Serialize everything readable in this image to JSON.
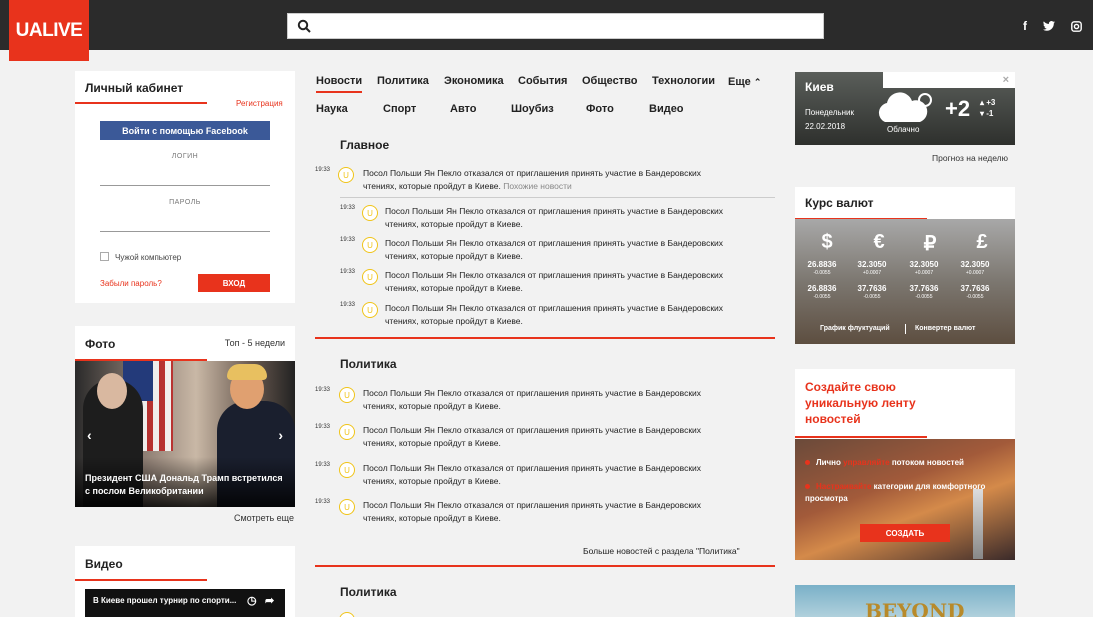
{
  "header": {
    "logo": "UALIVE",
    "search_placeholder": "",
    "social": [
      "f",
      "t",
      "ig"
    ]
  },
  "login": {
    "title": "Личный кабинет",
    "register": "Регистрация",
    "facebook": "Войти с помощью Facebook",
    "login_label": "ЛОГИН",
    "password_label": "ПАРОЛЬ",
    "remember": "Чужой компьютер",
    "forgot": "Забыли пароль?",
    "submit": "ВХОД"
  },
  "photo": {
    "title": "Фото",
    "filter": "Топ - 5 недели",
    "caption": "Президент США Дональд Трамп встретился с послом Великобритании",
    "more": "Смотреть еще"
  },
  "video": {
    "title": "Видео",
    "caption": "В Киеве прошел турнир по спорти..."
  },
  "tabs_row1": [
    "Новости",
    "Политика",
    "Экономика",
    "События",
    "Общество",
    "Технологии",
    "Еще"
  ],
  "tabs_row2": [
    "Наука",
    "Спорт",
    "Авто",
    "Шоубиз",
    "Фото",
    "Видео"
  ],
  "main": {
    "title": "Главное",
    "headline": {
      "time": "19:33",
      "line1": "Посол Польши Ян Пекло отказался от приглашения принять участие в Бандеровских",
      "line2": "чтениях, которые пройдут в Киеве.",
      "similar": "Похожие новости"
    },
    "related": [
      {
        "time": "19:33",
        "line1": "Посол Польши Ян Пекло отказался от приглашения принять участие в Бандеровских",
        "line2": "чтениях, которые пройдут в Киеве."
      },
      {
        "time": "19:33",
        "line1": "Посол Польши Ян Пекло отказался от приглашения принять участие в Бандеровских",
        "line2": "чтениях, которые пройдут в Киеве."
      },
      {
        "time": "19:33",
        "line1": "Посол Польши Ян Пекло отказался от приглашения принять участие в Бандеровских",
        "line2": "чтениях, которые пройдут в Киеве."
      },
      {
        "time": "19:33",
        "line1": "Посол Польши Ян Пекло отказался от приглашения принять участие в Бандеровских",
        "line2": "чтениях, которые пройдут в Киеве."
      }
    ]
  },
  "politics": {
    "title": "Политика",
    "items": [
      {
        "time": "19:33",
        "line1": "Посол Польши Ян Пекло отказался от приглашения принять участие в Бандеровских",
        "line2": "чтениях, которые пройдут в Киеве."
      },
      {
        "time": "19:33",
        "line1": "Посол Польши Ян Пекло отказался от приглашения принять участие в Бандеровских",
        "line2": "чтениях, которые пройдут в Киеве."
      },
      {
        "time": "19:33",
        "line1": "Посол Польши Ян Пекло отказался от приглашения принять участие в Бандеровских",
        "line2": "чтениях, которые пройдут в Киеве."
      },
      {
        "time": "19:33",
        "line1": "Посол Польши Ян Пекло отказался от приглашения принять участие в Бандеровских",
        "line2": "чтениях, которые пройдут в Киеве."
      }
    ],
    "more": "Больше новостей с раздела \"Политика\""
  },
  "politics2": {
    "title": "Политика"
  },
  "weather": {
    "city": "Киев",
    "day": "Понедельник",
    "date": "22.02.2018",
    "condition": "Облачно",
    "temp": "+2",
    "hi": "+3",
    "lo": "-1",
    "forecast": "Прогноз на неделю"
  },
  "currency": {
    "title": "Курс валют",
    "symbols": [
      "$",
      "€",
      "₽",
      "£"
    ],
    "row1": [
      "26.8836",
      "32.3050",
      "32.3050",
      "32.3050"
    ],
    "row1_delta": [
      "-0.0055",
      "+0.0007",
      "+0.0007",
      "+0.0007"
    ],
    "row2": [
      "26.8836",
      "37.7636",
      "37.7636",
      "37.7636"
    ],
    "row2_delta": [
      "-0.0055",
      "-0.0055",
      "-0.0055",
      "-0.0055"
    ],
    "chart_link": "График флуктуаций",
    "converter_link": "Конвертер валют"
  },
  "promo": {
    "title": "Создайте свою уникальную ленту новостей",
    "line1_pre": "Лично",
    "line1_red": "управляйте",
    "line1_post": "потоком новостей",
    "line2_red": "Настраивайте",
    "line2_post": "категории для комфортного просмотра",
    "button": "СОЗДАТЬ"
  },
  "game_banner": {
    "title": "BEYOND"
  }
}
